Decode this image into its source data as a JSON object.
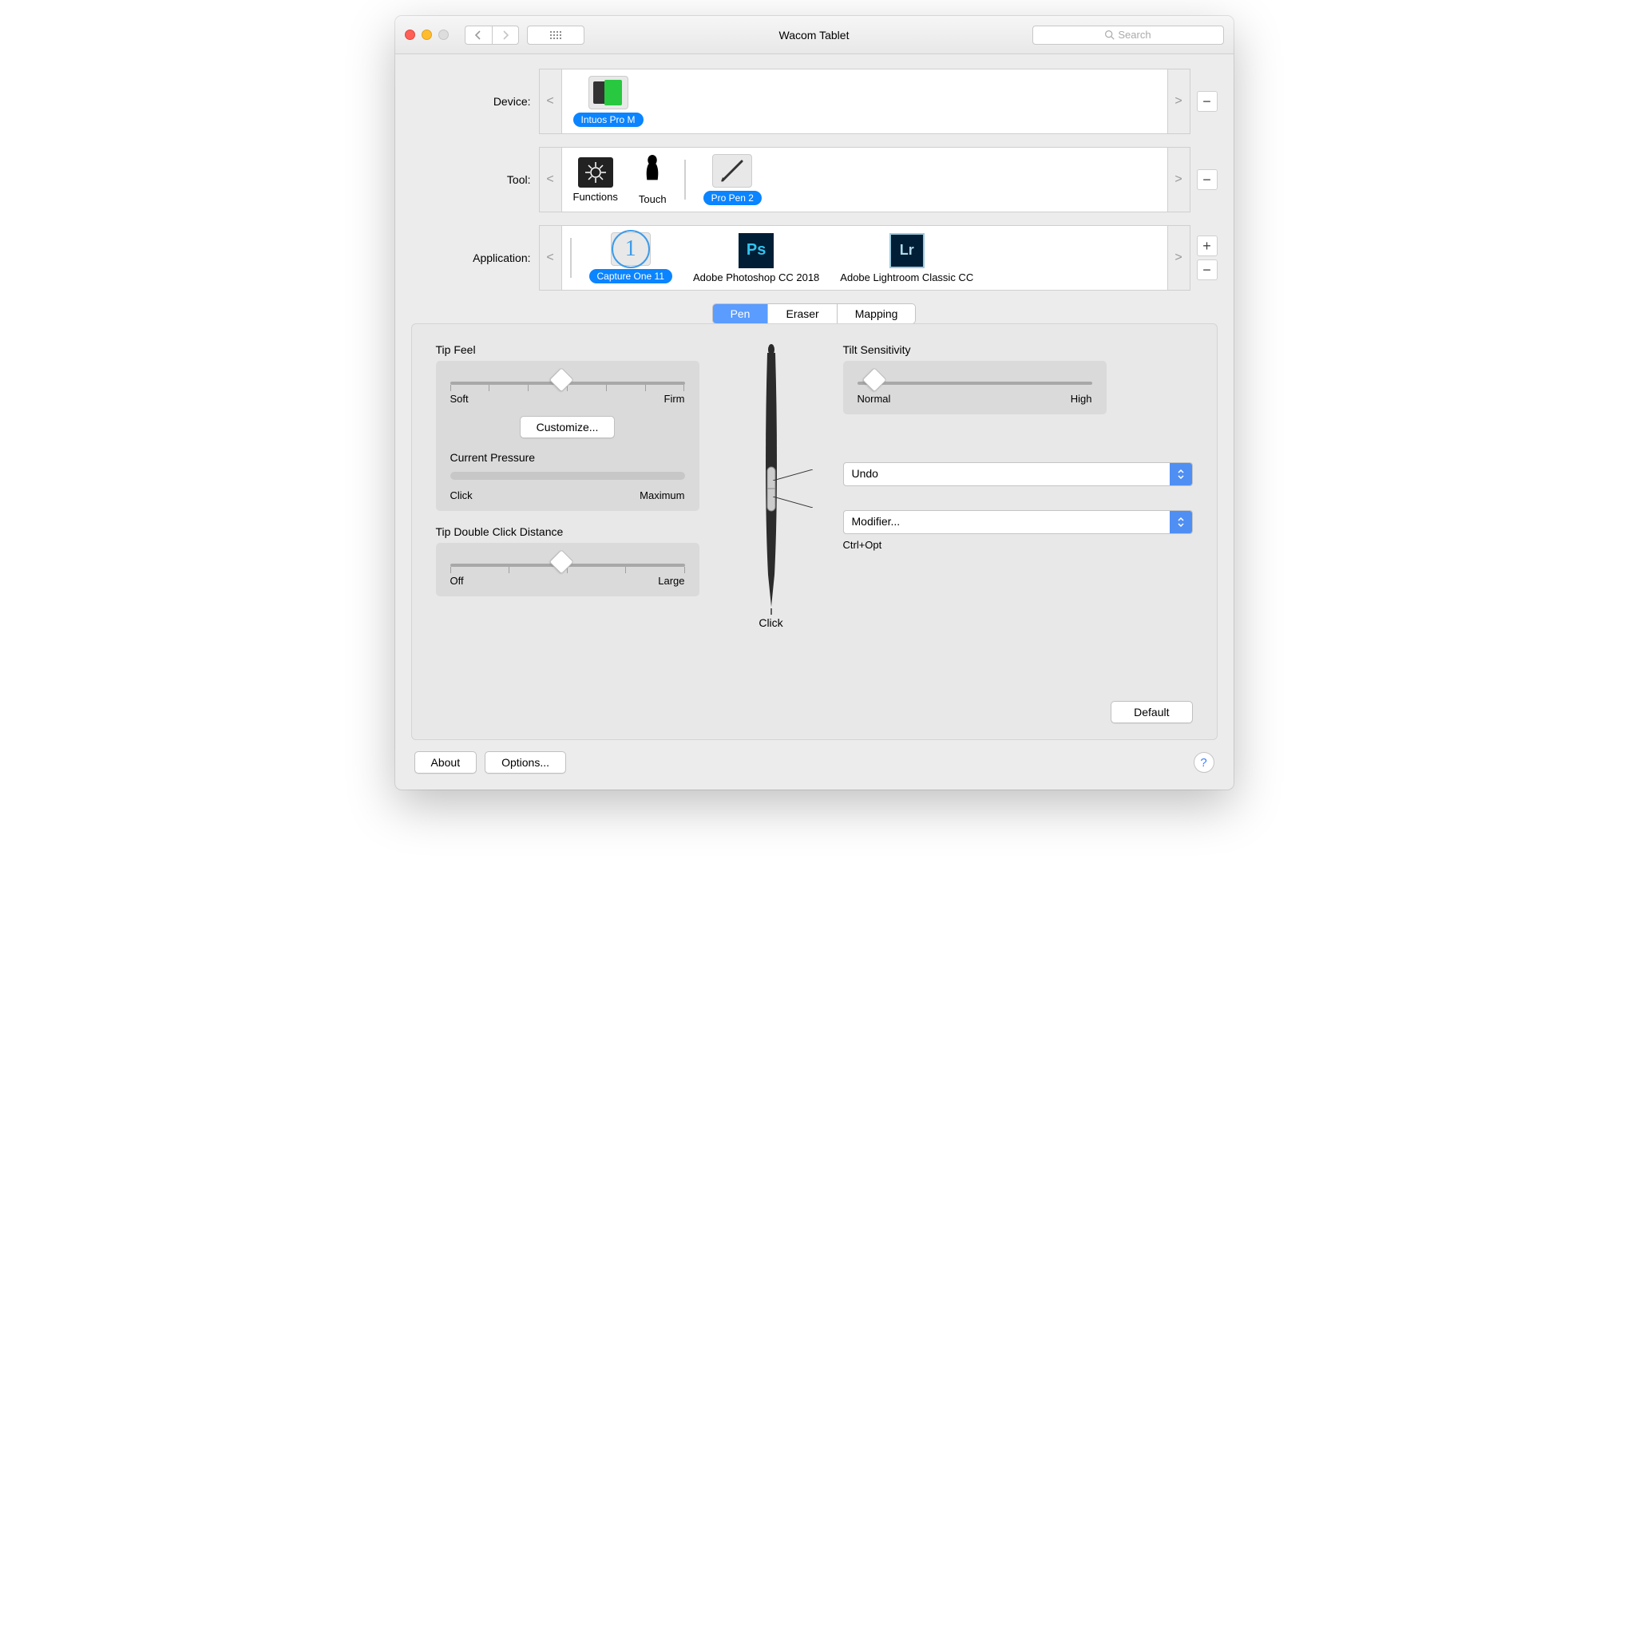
{
  "window": {
    "title": "Wacom Tablet"
  },
  "search": {
    "placeholder": "Search"
  },
  "labels": {
    "device": "Device:",
    "tool": "Tool:",
    "application": "Application:"
  },
  "device": {
    "items": [
      {
        "name": "Intuos Pro M",
        "selected": true
      }
    ]
  },
  "tool": {
    "items": [
      {
        "name": "Functions",
        "selected": false
      },
      {
        "name": "Touch",
        "selected": false
      },
      {
        "name": "Pro Pen 2",
        "selected": true
      }
    ]
  },
  "application": {
    "items": [
      {
        "name": "Capture One 11",
        "selected": true
      },
      {
        "name": "Adobe Photoshop CC 2018",
        "selected": false
      },
      {
        "name": "Adobe Lightroom Classic CC",
        "selected": false
      }
    ]
  },
  "tabs": [
    {
      "name": "Pen",
      "active": true
    },
    {
      "name": "Eraser",
      "active": false
    },
    {
      "name": "Mapping",
      "active": false
    }
  ],
  "pen": {
    "tipFeel": {
      "title": "Tip Feel",
      "leftLabel": "Soft",
      "rightLabel": "Firm",
      "customize": "Customize..."
    },
    "currentPressure": {
      "title": "Current Pressure",
      "leftLabel": "Click",
      "rightLabel": "Maximum"
    },
    "doubleClick": {
      "title": "Tip Double Click Distance",
      "leftLabel": "Off",
      "rightLabel": "Large"
    },
    "tilt": {
      "title": "Tilt Sensitivity",
      "leftLabel": "Normal",
      "rightLabel": "High"
    },
    "upperButton": {
      "value": "Undo"
    },
    "lowerButton": {
      "value": "Modifier...",
      "sub": "Ctrl+Opt"
    },
    "clickLabel": "Click",
    "default": "Default"
  },
  "footer": {
    "about": "About",
    "options": "Options..."
  }
}
